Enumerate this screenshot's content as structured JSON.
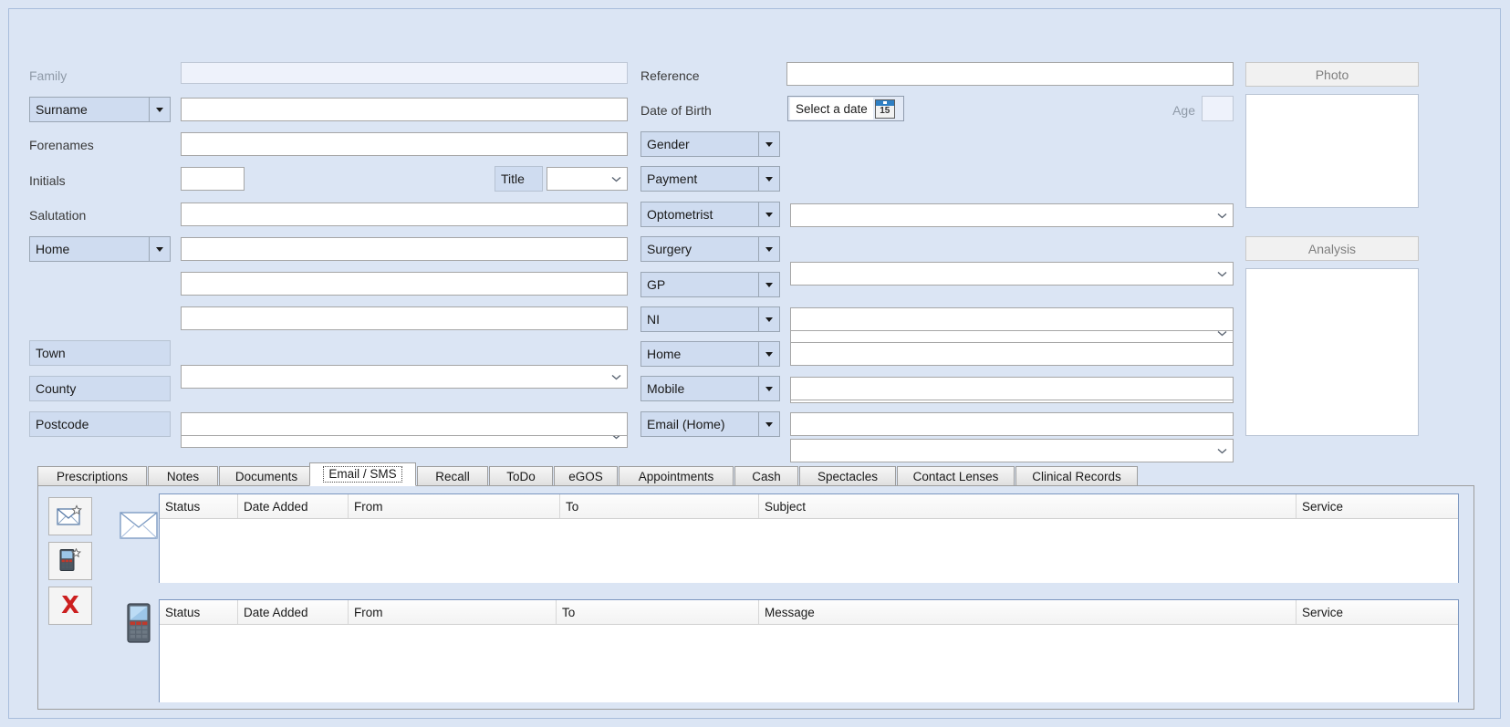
{
  "theme": {
    "background": "#dbe5f4",
    "label_button_bg": "#cfdcf0",
    "input_bg": "#ffffff",
    "disabled_input_bg": "#eef2fb",
    "tab_active_bg": "#ffffff",
    "grid_border": "#7b96bf",
    "muted_text": "#8f9aa8",
    "accent_blue": "#2e7fc4",
    "delete_red": "#cc1f1f"
  },
  "form": {
    "left_column": [
      {
        "name": "family",
        "label": "Family",
        "type": "static-label-muted",
        "value": "",
        "disabled": true
      },
      {
        "name": "surname",
        "label": "Surname",
        "type": "dropdown-label",
        "value": ""
      },
      {
        "name": "forenames",
        "label": "Forenames",
        "type": "static-label",
        "value": ""
      },
      {
        "name": "initials",
        "label": "Initials",
        "type": "static-label",
        "value": ""
      },
      {
        "name": "salutation",
        "label": "Salutation",
        "type": "static-label",
        "value": ""
      },
      {
        "name": "home-address",
        "label": "Home",
        "type": "dropdown-label",
        "value": ""
      },
      {
        "name": "address-2",
        "label": "",
        "type": "static-label",
        "value": ""
      },
      {
        "name": "address-3",
        "label": "",
        "type": "static-label",
        "value": ""
      },
      {
        "name": "town",
        "label": "Town",
        "type": "flat-label",
        "value": ""
      },
      {
        "name": "county",
        "label": "County",
        "type": "flat-label",
        "value": ""
      },
      {
        "name": "postcode",
        "label": "Postcode",
        "type": "flat-label",
        "value": ""
      }
    ],
    "title_field": {
      "label": "Title",
      "value": ""
    },
    "middle_column": [
      {
        "name": "reference",
        "label": "Reference",
        "type": "static-label",
        "value": ""
      },
      {
        "name": "date-of-birth",
        "label": "Date of Birth",
        "type": "static-label",
        "value": ""
      },
      {
        "name": "gender",
        "label": "Gender",
        "type": "dropdown-label",
        "value": ""
      },
      {
        "name": "payment",
        "label": "Payment",
        "type": "dropdown-label",
        "value": ""
      },
      {
        "name": "optometrist",
        "label": "Optometrist",
        "type": "dropdown-label",
        "value": ""
      },
      {
        "name": "surgery",
        "label": "Surgery",
        "type": "dropdown-label",
        "value": ""
      },
      {
        "name": "gp",
        "label": "GP",
        "type": "dropdown-label",
        "value": ""
      },
      {
        "name": "ni",
        "label": "NI",
        "type": "dropdown-label",
        "value": ""
      },
      {
        "name": "home-phone",
        "label": "Home",
        "type": "dropdown-label",
        "value": ""
      },
      {
        "name": "mobile-phone",
        "label": "Mobile",
        "type": "dropdown-label",
        "value": ""
      },
      {
        "name": "email-home",
        "label": "Email (Home)",
        "type": "dropdown-label",
        "value": ""
      }
    ],
    "date_of_birth": {
      "placeholder": "Select a date",
      "value": "",
      "calendar_day": "15"
    },
    "age": {
      "label": "Age",
      "value": "",
      "disabled": true
    }
  },
  "panels": {
    "photo": {
      "title": "Photo",
      "content": ""
    },
    "analysis": {
      "title": "Analysis",
      "content": ""
    }
  },
  "tabs": [
    {
      "label": "Prescriptions",
      "active": false
    },
    {
      "label": "Notes",
      "active": false
    },
    {
      "label": "Documents",
      "active": false
    },
    {
      "label": "Email / SMS",
      "active": true
    },
    {
      "label": "Recall",
      "active": false
    },
    {
      "label": "ToDo",
      "active": false
    },
    {
      "label": "eGOS",
      "active": false
    },
    {
      "label": "Appointments",
      "active": false
    },
    {
      "label": "Cash",
      "active": false
    },
    {
      "label": "Spectacles",
      "active": false
    },
    {
      "label": "Contact Lenses",
      "active": false
    },
    {
      "label": "Clinical Records",
      "active": false
    }
  ],
  "email_sms_tab": {
    "toolbar": [
      {
        "name": "new-email-button",
        "icon": "new-email-icon"
      },
      {
        "name": "new-sms-button",
        "icon": "new-sms-icon"
      },
      {
        "name": "delete-button",
        "icon": "delete-x-icon"
      }
    ],
    "decorations": [
      {
        "name": "envelope-icon"
      },
      {
        "name": "mobile-phone-icon"
      }
    ],
    "email_grid": {
      "columns": [
        "Status",
        "Date Added",
        "From",
        "To",
        "Subject",
        "Service"
      ],
      "rows": []
    },
    "sms_grid": {
      "columns": [
        "Status",
        "Date Added",
        "From",
        "To",
        "Message",
        "Service"
      ],
      "rows": []
    }
  }
}
